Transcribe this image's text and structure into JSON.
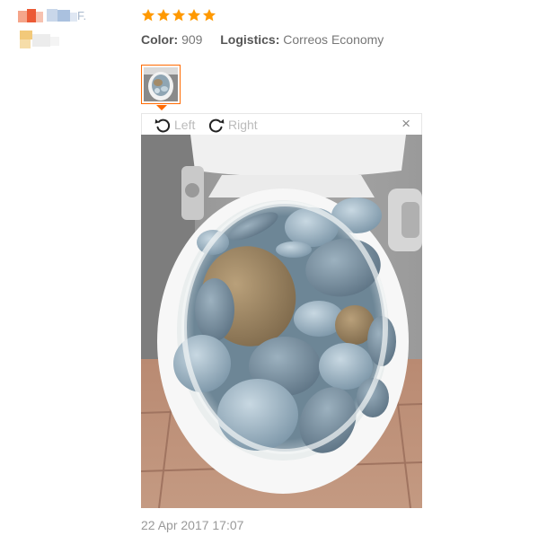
{
  "review": {
    "user_suffix": "F.",
    "rating": 5,
    "meta": {
      "color_label": "Color:",
      "color_value": "909",
      "logistics_label": "Logistics:",
      "logistics_value": "Correos Economy"
    },
    "viewer": {
      "rotate_left_label": "Left",
      "rotate_right_label": "Right",
      "close_label": "×"
    },
    "date": "22 Apr 2017 17:07"
  },
  "colors": {
    "star": "#ff9900",
    "accent": "#ff6a00"
  }
}
